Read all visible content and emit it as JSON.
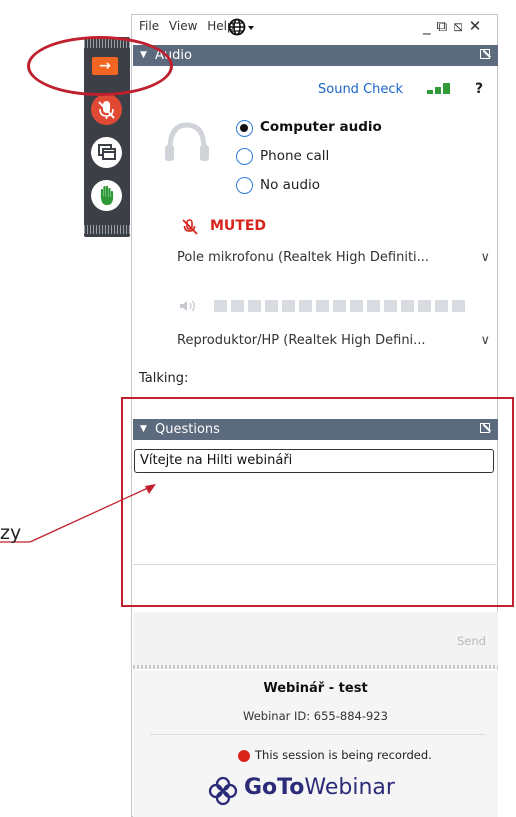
{
  "menu": {
    "file": "File",
    "view": "View",
    "help": "Help"
  },
  "window_controls": {
    "minimize": "_",
    "restore": "⧉",
    "popout": "⧅",
    "close": "✕"
  },
  "audio": {
    "header": "Audio",
    "sound_check": "Sound Check",
    "help": "?",
    "options": [
      {
        "label": "Computer audio",
        "selected": true
      },
      {
        "label": "Phone call",
        "selected": false
      },
      {
        "label": "No audio",
        "selected": false
      }
    ],
    "muted_label": "MUTED",
    "microphone": "Pole mikrofonu (Realtek High Definiti...",
    "speaker": "Reproduktor/HP (Realtek High Defini...",
    "talking_label": "Talking:"
  },
  "questions": {
    "header": "Questions",
    "message": "Vítejte na Hilti webináři",
    "send_label": "Send"
  },
  "footer": {
    "title": "Webinář - test",
    "webinar_id": "Webinar ID: 655-884-923",
    "recording": "This session is being recorded.",
    "brand_goto": "GoTo",
    "brand_webinar": "Webinar"
  },
  "annotation": {
    "side_text": "zy"
  },
  "colors": {
    "orange": "#f26522",
    "red": "#d9241c",
    "header": "#5c6a7e",
    "blue": "#1a66c9",
    "green": "#2e9a38",
    "annotation": "#c0202e"
  }
}
